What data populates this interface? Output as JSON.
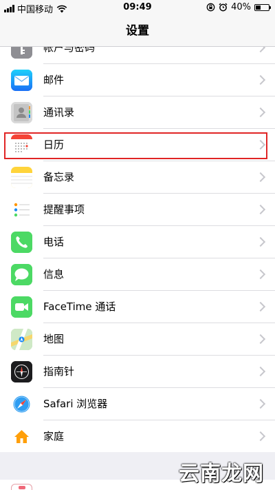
{
  "status_bar": {
    "carrier": "中国移动",
    "time": "09:49",
    "battery": "40%",
    "battery_level": 0.4
  },
  "nav": {
    "title": "设置"
  },
  "rows": [
    {
      "label": "帐户与密码",
      "icon": "key-icon",
      "color": "#8e8e93"
    },
    {
      "label": "邮件",
      "icon": "mail-icon",
      "color": "#1b8cf5"
    },
    {
      "label": "通讯录",
      "icon": "contacts-icon",
      "color": "#bfbfbf"
    },
    {
      "label": "日历",
      "icon": "calendar-icon",
      "color": "#ffffff"
    },
    {
      "label": "备忘录",
      "icon": "notes-icon",
      "color": "#ffd43b"
    },
    {
      "label": "提醒事项",
      "icon": "reminders-icon",
      "color": "#ffffff"
    },
    {
      "label": "电话",
      "icon": "phone-icon",
      "color": "#4cd964"
    },
    {
      "label": "信息",
      "icon": "messages-icon",
      "color": "#4cd964"
    },
    {
      "label": "FaceTime 通话",
      "icon": "facetime-icon",
      "color": "#4cd964"
    },
    {
      "label": "地图",
      "icon": "maps-icon",
      "color": "#7fc97a"
    },
    {
      "label": "指南针",
      "icon": "compass-icon",
      "color": "#1c1c1e"
    },
    {
      "label": "Safari 浏览器",
      "icon": "safari-icon",
      "color": "#ffffff"
    },
    {
      "label": "家庭",
      "icon": "home-icon",
      "color": "#ffffff"
    }
  ],
  "highlight_color": "#e02424",
  "watermark": "云南龙网"
}
